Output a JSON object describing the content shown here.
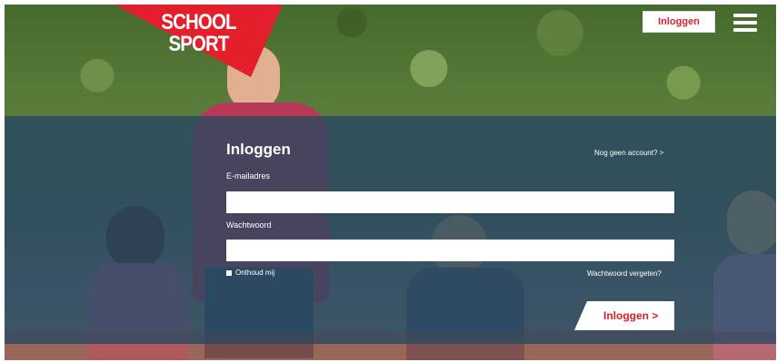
{
  "brand": {
    "line1": "SCHOOL",
    "line2": "SPORT",
    "color": "#e41e2b"
  },
  "header": {
    "login_button": "Inloggen",
    "menu_icon": "hamburger-menu-icon"
  },
  "form": {
    "title": "Inloggen",
    "no_account_link": "Nog geen account? >",
    "email_label": "E-mailadres",
    "email_value": "",
    "password_label": "Wachtwoord",
    "password_value": "",
    "remember_label": "Onthoud mij",
    "forgot_link": "Wachtwoord vergeten?",
    "submit_label": "Inloggen >"
  },
  "colors": {
    "accent": "#d71e2b",
    "overlay": "#264862"
  }
}
